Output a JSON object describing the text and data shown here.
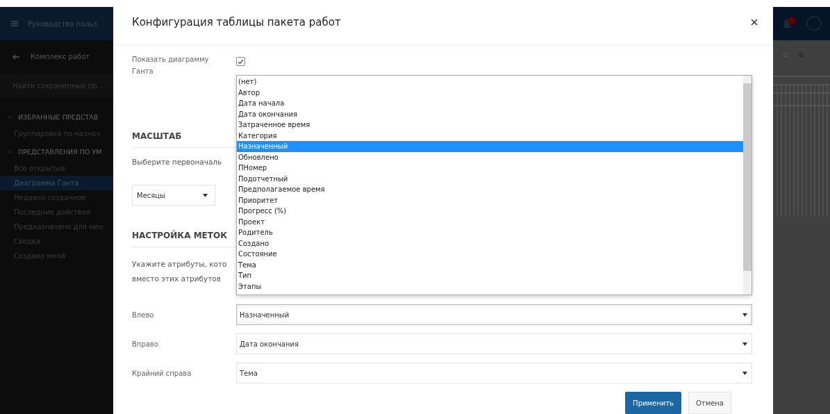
{
  "app_header": {
    "title": "Руководство польз"
  },
  "sidebar": {
    "back_label": "Комплекс работ",
    "search": {
      "placeholder": "Найти сохраненные пр..."
    },
    "sections": [
      {
        "title": "ИЗБРАННЫЕ ПРЕДСТАВ",
        "expanded": true,
        "items": [
          {
            "label": "Группировка по назнач",
            "selected": false
          }
        ]
      },
      {
        "title": "ПРЕДСТАВЛЕНИЯ ПО УМ",
        "expanded": true,
        "items": [
          {
            "label": "Все открытые",
            "selected": false
          },
          {
            "label": "Диаграмма Ганта",
            "selected": true
          },
          {
            "label": "Недавно созданное",
            "selected": false
          },
          {
            "label": "Последние действия",
            "selected": false
          },
          {
            "label": "Предназначено для мен",
            "selected": false
          },
          {
            "label": "Сводка",
            "selected": false
          },
          {
            "label": "Создано мной",
            "selected": false
          }
        ]
      }
    ]
  },
  "dialog": {
    "title": "Конфигурация таблицы пакета работ",
    "show_gantt": {
      "label": "Показать диаграмму Ганта",
      "checked": true
    },
    "scale": {
      "heading": "МАСШТАБ",
      "text": "Выберите первоначаль",
      "select": {
        "value": "Месяцы"
      }
    },
    "labels": {
      "heading": "НАСТРОЙКА МЕТОК",
      "text_lines": [
        "Укажите атрибуты, кото",
        "вместо этих атрибутов"
      ],
      "fields": [
        {
          "label": "Влево",
          "value": "Назначенный",
          "focused": true
        },
        {
          "label": "Вправо",
          "value": "Дата окончания",
          "focused": false
        },
        {
          "label": "Крайний справа",
          "value": "Тема",
          "focused": false
        }
      ]
    },
    "dropdown": {
      "options": [
        {
          "label": "(нет)",
          "selected": false
        },
        {
          "label": "Автор",
          "selected": false
        },
        {
          "label": "Дата начала",
          "selected": false
        },
        {
          "label": "Дата окончания",
          "selected": false
        },
        {
          "label": "Затраченное время",
          "selected": false
        },
        {
          "label": "Категория",
          "selected": false
        },
        {
          "label": "Назначенный",
          "selected": true
        },
        {
          "label": "Обновлено",
          "selected": false
        },
        {
          "label": "ПНомер",
          "selected": false
        },
        {
          "label": "Подотчетный",
          "selected": false
        },
        {
          "label": "Предполагаемое время",
          "selected": false
        },
        {
          "label": "Приоритет",
          "selected": false
        },
        {
          "label": "Прогресс (%)",
          "selected": false
        },
        {
          "label": "Проект",
          "selected": false
        },
        {
          "label": "Родитель",
          "selected": false
        },
        {
          "label": "Создано",
          "selected": false
        },
        {
          "label": "Состояние",
          "selected": false
        },
        {
          "label": "Тема",
          "selected": false
        },
        {
          "label": "Тип",
          "selected": false
        },
        {
          "label": "Этапы",
          "selected": false
        }
      ]
    },
    "buttons": [
      {
        "label": "Применить",
        "kind": "primary"
      },
      {
        "label": "Отмена",
        "kind": "secondary"
      }
    ]
  }
}
